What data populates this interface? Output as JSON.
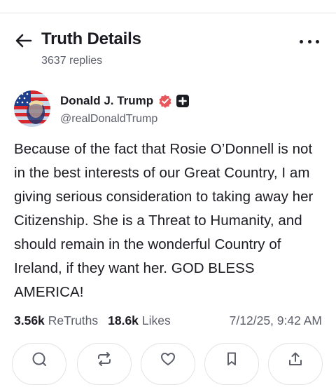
{
  "header": {
    "title": "Truth Details",
    "subtitle": "3637 replies"
  },
  "author": {
    "name": "Donald J. Trump",
    "handle": "@realDonaldTrump",
    "verified_color": "#e8555b"
  },
  "post": {
    "text": "Because of the fact that Rosie O’Donnell is not in the best interests of our Great Country, I am giving serious consideration to taking away her Citizenship. She is a Threat to Humanity, and should remain in the wonderful Country of Ireland, if they want her. GOD BLESS AMERICA!"
  },
  "stats": {
    "retruths_count": "3.56k",
    "retruths_label": "ReTruths",
    "likes_count": "18.6k",
    "likes_label": "Likes",
    "timestamp": "7/12/25, 9:42 AM"
  },
  "actions": [
    {
      "icon": "reply-icon"
    },
    {
      "icon": "retruth-icon"
    },
    {
      "icon": "like-heart-icon"
    },
    {
      "icon": "bookmark-icon"
    },
    {
      "icon": "share-upload-icon"
    }
  ]
}
